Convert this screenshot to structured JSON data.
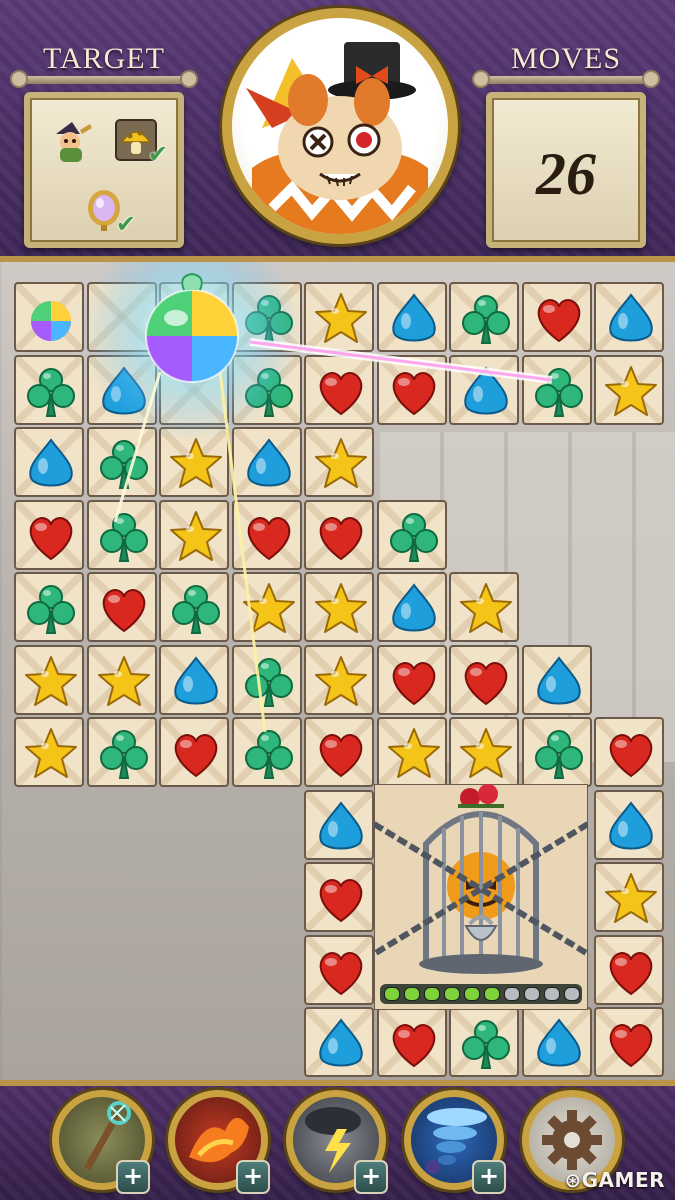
{
  "header": {
    "target_label": "TARGET",
    "moves_label": "MOVES",
    "moves_value": "26",
    "targets": [
      {
        "icon": "witch-character-icon",
        "completed": false
      },
      {
        "icon": "mushroom-tile-icon",
        "completed": true
      },
      {
        "icon": "mirror-icon",
        "completed": true
      }
    ],
    "portrait": "jester-cat-boss-portrait"
  },
  "board": {
    "rows": [
      [
        "rainbow",
        "empty",
        "empty",
        "clover",
        "star",
        "drop",
        "clover",
        "heart",
        "drop"
      ],
      [
        "clover",
        "drop",
        "empty",
        "clover",
        "heart",
        "heart",
        "drop",
        "clover",
        "star"
      ],
      [
        "drop",
        "clover",
        "star",
        "drop",
        "star",
        "",
        "",
        "",
        ""
      ],
      [
        "heart",
        "clover",
        "star",
        "heart",
        "heart",
        "clover",
        "",
        "",
        ""
      ],
      [
        "clover",
        "heart",
        "clover",
        "star",
        "star",
        "drop",
        "star",
        "",
        ""
      ],
      [
        "star",
        "star",
        "drop",
        "clover",
        "star",
        "heart",
        "heart",
        "drop",
        ""
      ],
      [
        "star",
        "clover",
        "heart",
        "clover",
        "heart",
        "star",
        "star",
        "clover",
        "heart"
      ],
      [
        "",
        "",
        "",
        "",
        "drop",
        "cage",
        "cage",
        "cage",
        "drop"
      ],
      [
        "",
        "",
        "",
        "",
        "heart",
        "cage",
        "cage",
        "cage",
        "star"
      ],
      [
        "",
        "",
        "",
        "",
        "heart",
        "cage",
        "cage",
        "cage",
        "heart"
      ],
      [
        "",
        "",
        "",
        "",
        "drop",
        "heart",
        "clover",
        "drop",
        "heart"
      ]
    ],
    "cage_progress": {
      "filled": 6,
      "total": 10
    },
    "gem_colors": {
      "heart": "#d8281f",
      "drop": "#1e9fdc",
      "star": "#f5c418",
      "clover": "#2fb67a"
    }
  },
  "boosters": [
    {
      "icon": "magic-staff-icon",
      "plus": "+"
    },
    {
      "icon": "fire-fox-icon",
      "plus": "+"
    },
    {
      "icon": "lightning-storm-icon",
      "plus": "+"
    },
    {
      "icon": "tornado-icon",
      "plus": "+"
    },
    {
      "icon": "gear-icon"
    }
  ],
  "watermark": "GAMER"
}
